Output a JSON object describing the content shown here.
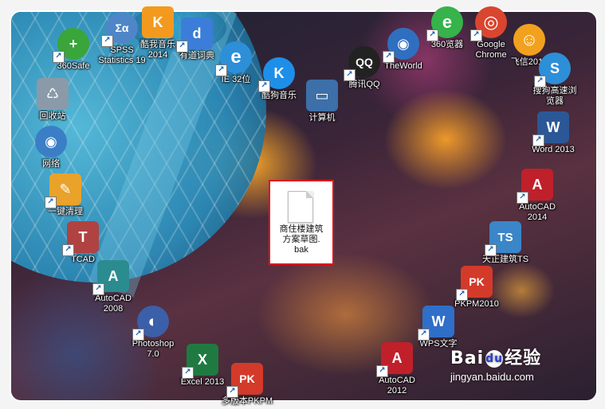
{
  "desktop": {
    "icons": [
      {
        "label": "360Safe",
        "glyph": "+",
        "color": "#3aa53a"
      },
      {
        "label": "SPSS\nStatistics 19",
        "glyph": "Σα",
        "color": "#4e86c8"
      },
      {
        "label": "酷我音乐\n2014",
        "glyph": "K",
        "color": "#f39a1e"
      },
      {
        "label": "有道词典",
        "glyph": "d",
        "color": "#3b7dd8"
      },
      {
        "label": "IE 32位",
        "glyph": "e",
        "color": "#2d8fd8"
      },
      {
        "label": "酷狗音乐",
        "glyph": "K",
        "color": "#1e8fe8"
      },
      {
        "label": "计算机",
        "glyph": "▭",
        "color": "#3d6fa8"
      },
      {
        "label": "腾讯QQ",
        "glyph": "QQ",
        "color": "#222222"
      },
      {
        "label": "TheWorld",
        "glyph": "◉",
        "color": "#2f6fc0"
      },
      {
        "label": "360览器",
        "glyph": "e",
        "color": "#36b34a"
      },
      {
        "label": "Google\nChrome",
        "glyph": "◎",
        "color": "#d9452f"
      },
      {
        "label": "飞信2013",
        "glyph": "☺",
        "color": "#f2a11f"
      },
      {
        "label": "回收站",
        "glyph": "♺",
        "color": "#8a9aa8"
      },
      {
        "label": "网络",
        "glyph": "◉",
        "color": "#3b7ec6"
      },
      {
        "label": "一键清理",
        "glyph": "✎",
        "color": "#e9a22a"
      },
      {
        "label": "TCAD",
        "glyph": "T",
        "color": "#b04242"
      },
      {
        "label": "AutoCAD\n2008",
        "glyph": "A",
        "color": "#2a8c8f"
      },
      {
        "label": "Photoshop\n7.0",
        "glyph": "◐",
        "color": "#3b5fa8"
      },
      {
        "label": "Excel 2013",
        "glyph": "X",
        "color": "#1f7a42"
      },
      {
        "label": "多版本PKPM",
        "glyph": "PK",
        "color": "#d33a2a"
      },
      {
        "label": "AutoCAD\n2012",
        "glyph": "A",
        "color": "#c0202a"
      },
      {
        "label": "WPS文字",
        "glyph": "W",
        "color": "#2f6fc9"
      },
      {
        "label": "PKPM2010",
        "glyph": "PK",
        "color": "#d33a2a"
      },
      {
        "label": "天正建筑TS",
        "glyph": "TS",
        "color": "#3a86c8"
      },
      {
        "label": "AutoCAD\n2014",
        "glyph": "A",
        "color": "#c0202a"
      },
      {
        "label": "Word 2013",
        "glyph": "W",
        "color": "#2b5797"
      },
      {
        "label": "搜狗高速浏\n览器",
        "glyph": "S",
        "color": "#2d8fd8"
      }
    ],
    "selected_file": {
      "label": "商住楼建筑\n方案草图.\nbak"
    }
  },
  "watermark": {
    "brand": "Bai",
    "paw": "du",
    "suffix": "经验",
    "url": "jingyan.baidu.com"
  }
}
